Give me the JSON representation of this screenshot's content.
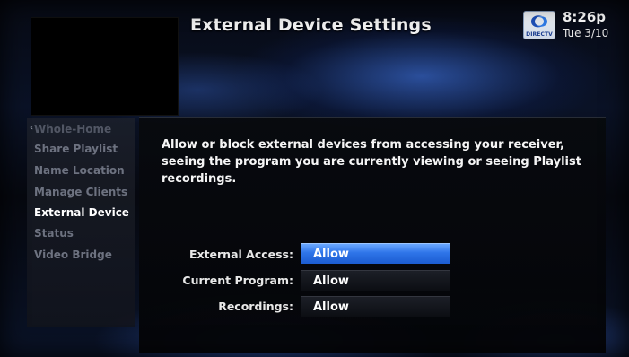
{
  "header": {
    "title": "External Device Settings",
    "logo_text": "DIRECTV",
    "time": "8:26p",
    "date": "Tue 3/10"
  },
  "sidebar": {
    "items": [
      {
        "label": "Whole-Home",
        "state": "faded"
      },
      {
        "label": "Share Playlist",
        "state": "normal"
      },
      {
        "label": "Name Location",
        "state": "normal"
      },
      {
        "label": "Manage Clients",
        "state": "normal"
      },
      {
        "label": "External Device",
        "state": "active"
      },
      {
        "label": "Status",
        "state": "normal"
      },
      {
        "label": "Video Bridge",
        "state": "normal"
      }
    ]
  },
  "main": {
    "description": "Allow or block external devices from accessing your receiver, seeing the program you are currently viewing or seeing Playlist recordings.",
    "settings": [
      {
        "label": "External Access:",
        "value": "Allow",
        "focused": true
      },
      {
        "label": "Current Program:",
        "value": "Allow",
        "focused": false
      },
      {
        "label": "Recordings:",
        "value": "Allow",
        "focused": false
      }
    ]
  },
  "colors": {
    "focus_blue": "#2e74e8",
    "text_white": "#f5f5f5",
    "menu_inactive": "#6d7280"
  }
}
